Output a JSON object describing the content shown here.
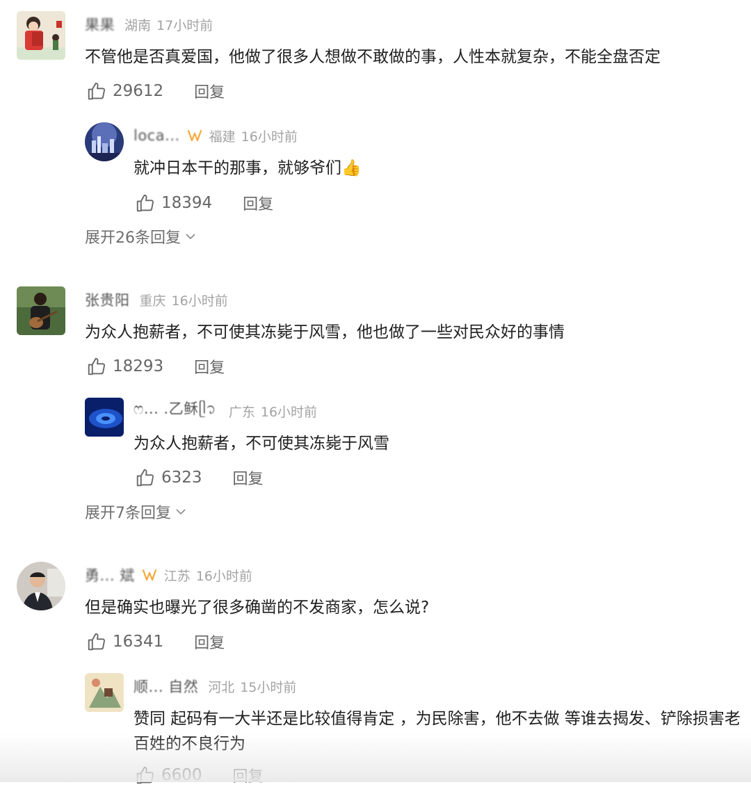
{
  "comments": [
    {
      "user": "果果",
      "location": "湖南",
      "time": "17小时前",
      "text": "不管他是否真爱国，他做了很多人想做不敢做的事，人性本就复杂，不能全盘否定",
      "likes": "29612",
      "reply_label": "回复",
      "avatar_icon": "cartoon-girl-avatar",
      "reply": {
        "user": "loca...",
        "badge": true,
        "location": "福建",
        "time": "16小时前",
        "text": "就冲日本干的那事，就够爷们👍",
        "likes": "18394",
        "reply_label": "回复",
        "avatar_icon": "night-city-avatar"
      },
      "expand_label": "展开26条回复"
    },
    {
      "user": "张贵阳",
      "location": "重庆",
      "time": "16小时前",
      "text": "为众人抱薪者，不可使其冻毙于风雪，他也做了一些对民众好的事情",
      "likes": "18293",
      "reply_label": "回复",
      "avatar_icon": "guitar-player-avatar",
      "reply": {
        "user": "ෆ... .乙稣ᥫ᭡",
        "badge": false,
        "location": "广东",
        "time": "16小时前",
        "text": "为众人抱薪者，不可使其冻毙于风雪",
        "likes": "6323",
        "reply_label": "回复",
        "avatar_icon": "blue-vortex-avatar"
      },
      "expand_label": "展开7条回复"
    },
    {
      "user": "勇... 斌",
      "badge": true,
      "location": "江苏",
      "time": "16小时前",
      "text": "但是确实也曝光了很多确凿的不发商家，怎么说?",
      "likes": "16341",
      "reply_label": "回复",
      "avatar_icon": "man-portrait-avatar",
      "reply": {
        "user": "顺... 自然",
        "badge": false,
        "location": "河北",
        "time": "15小时前",
        "text": "赞同 起码有一大半还是比较值得肯定 ，为民除害，他不去做 等谁去揭发、铲除损害老百姓的不良行为",
        "likes": "6600",
        "reply_label": "回复",
        "avatar_icon": "illustration-avatar"
      }
    }
  ],
  "colors": {
    "text": "#1f1f1f",
    "meta": "#a3a3a3",
    "action": "#666666",
    "badge_orange": "#f5a83a"
  }
}
